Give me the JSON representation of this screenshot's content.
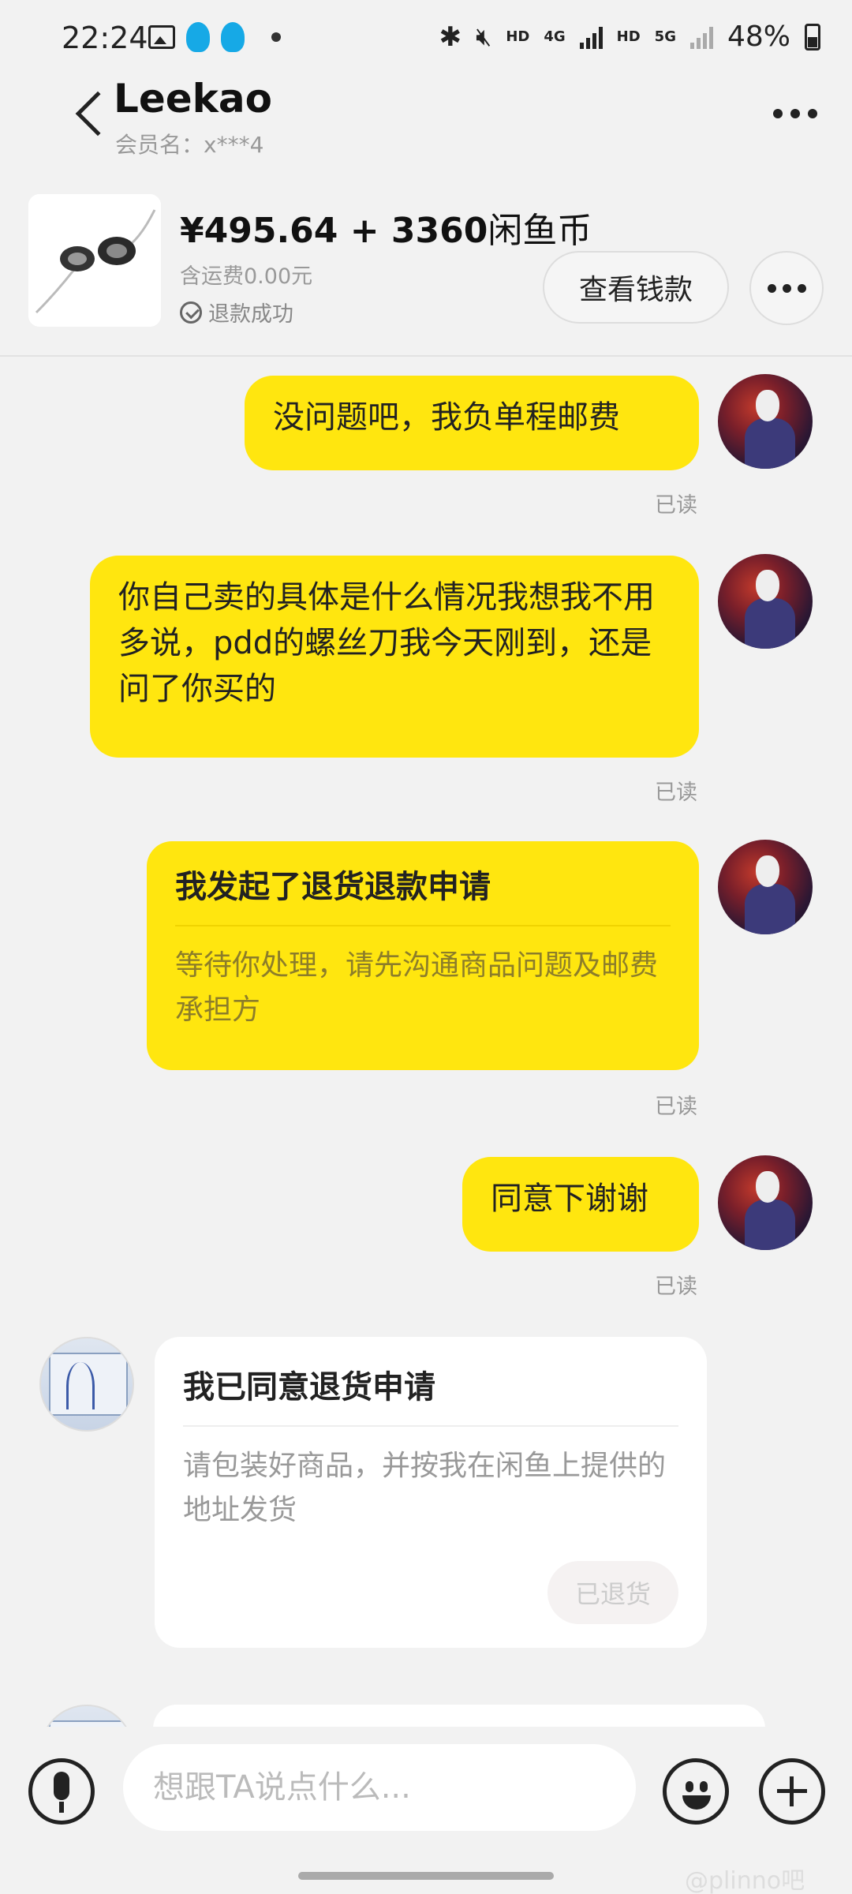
{
  "status_bar": {
    "time": "22:24",
    "network_left": "HD",
    "network_4g": "4G",
    "network_right": "HD",
    "network_5g": "5G",
    "battery": "48%"
  },
  "header": {
    "title": "Leekao",
    "member_name": "会员名：x***4"
  },
  "product": {
    "price": "¥495.64 + 3360",
    "price_suffix": "闲鱼币",
    "shipping": "含运费0.00元",
    "status": "退款成功",
    "view_payment_label": "查看钱款"
  },
  "messages": [
    {
      "text": "没问题吧，我负单程邮费",
      "read": "已读"
    },
    {
      "text": "你自己卖的具体是什么情况我想我不用多说，pdd的螺丝刀我今天刚到，还是问了你买的",
      "read": "已读"
    },
    {
      "title": "我发起了退货退款申请",
      "body": "等待你处理，请先沟通商品问题及邮费承担方",
      "read": "已读"
    },
    {
      "text": "同意下谢谢",
      "read": "已读"
    },
    {
      "title": "我已同意退货申请",
      "body": "请包装好商品，并按我在闲鱼上提供的地址发货",
      "button": "已退货"
    }
  ],
  "input": {
    "placeholder": "想跟TA说点什么..."
  },
  "watermark": "@plinno吧"
}
